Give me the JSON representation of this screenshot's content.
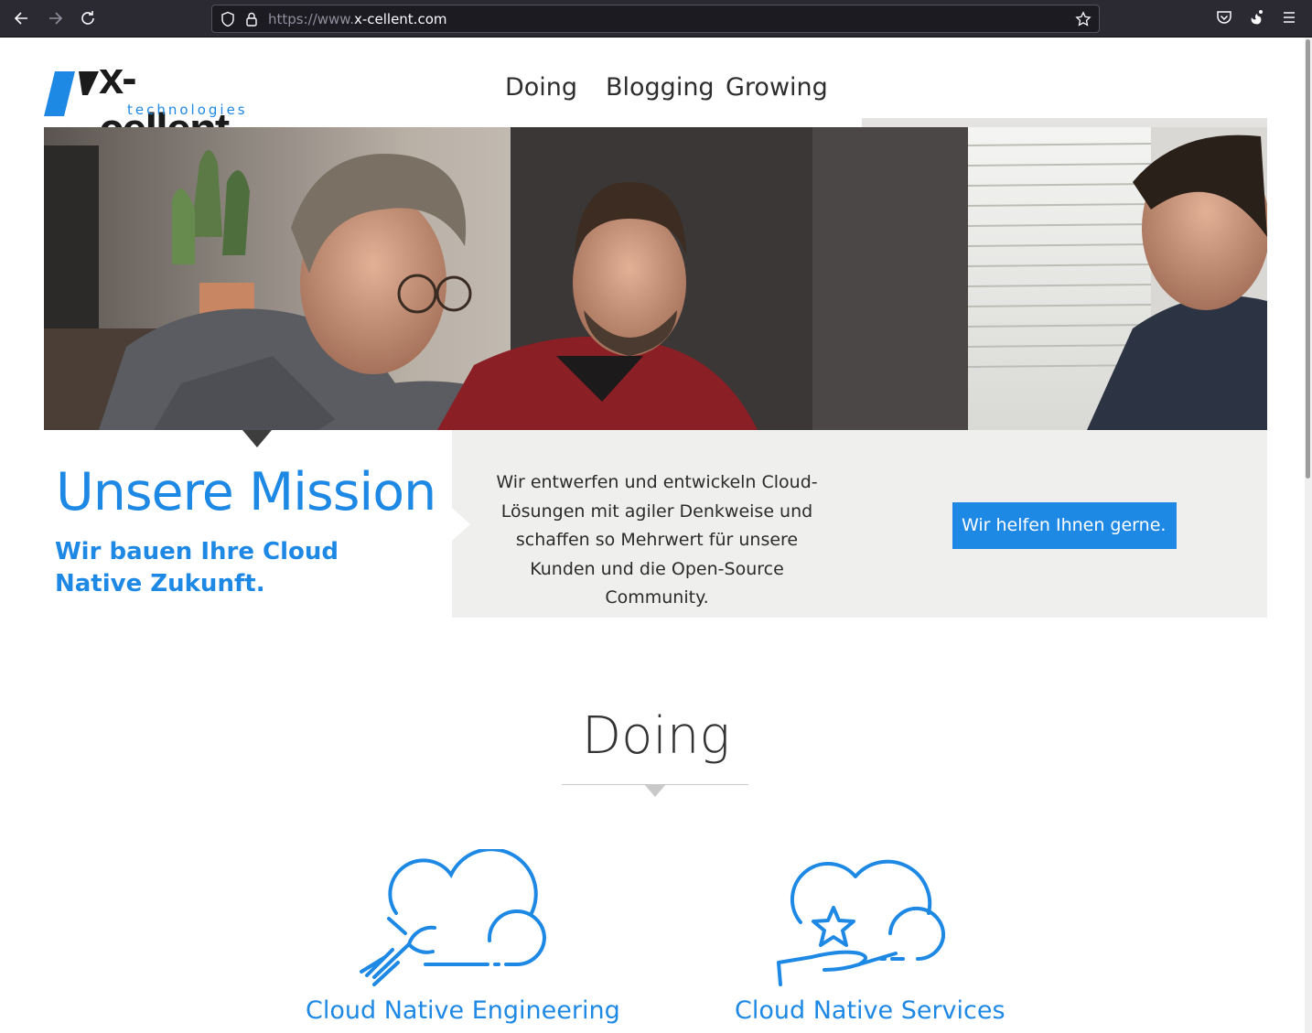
{
  "browser": {
    "url_prefix": "https://www.",
    "url_domain": "x-cellent.com",
    "icons": {
      "back": "arrow-left-icon",
      "forward": "arrow-right-icon",
      "reload": "reload-icon",
      "tracking": "shield-icon",
      "security": "lock-icon",
      "bookmark": "star-icon",
      "pocket": "pocket-icon",
      "extension": "gnome-icon",
      "menu": "hamburger-menu-icon"
    }
  },
  "header": {
    "logo_text": "x-cellent",
    "logo_sub": "technologies",
    "nav": [
      {
        "label": "Doing"
      },
      {
        "label": "Blogging"
      },
      {
        "label": "Growing"
      }
    ]
  },
  "mission": {
    "title": "Unsere Mission",
    "subtitle": "Wir bauen Ihre Cloud Native Zukunft.",
    "text": "Wir entwerfen und entwickeln Cloud-Lösungen mit agiler Denkweise und schaffen so Mehrwert für unsere Kunden und die Open-Source Community.",
    "cta_label": "Wir helfen Ihnen gerne."
  },
  "doing": {
    "title": "Doing",
    "services": [
      {
        "label": "Cloud Native Engineering",
        "icon": "cloud-wrench-icon"
      },
      {
        "label": "Cloud Native Services",
        "icon": "cloud-hand-star-icon"
      }
    ]
  },
  "colors": {
    "brand_blue": "#1e88e5",
    "text_dark": "#2d2d2d",
    "panel_gray": "#efefed",
    "chrome_bg": "#2b2a33"
  }
}
